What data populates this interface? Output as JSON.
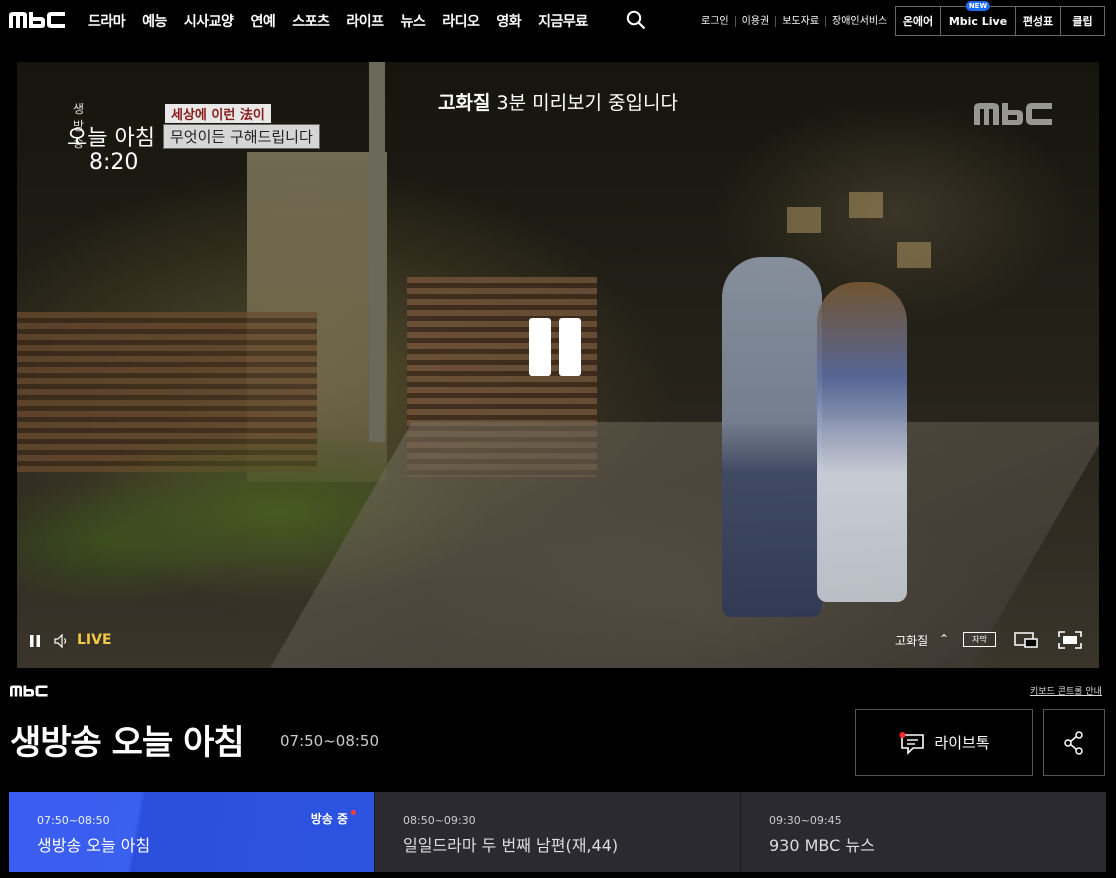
{
  "nav": {
    "logo": "MBC",
    "items": [
      "드라마",
      "예능",
      "시사교양",
      "연예",
      "스포츠",
      "라이프",
      "뉴스",
      "라디오",
      "영화",
      "지금무료"
    ],
    "util": [
      "로그인",
      "이용권",
      "보도자료",
      "장애인서비스"
    ],
    "buttons": {
      "onair": "온에어",
      "mbic_live": "Mbic Live",
      "mbic_new": "NEW",
      "schedule": "편성표",
      "clip": "클립"
    }
  },
  "player": {
    "bug_small": "생방송",
    "bug_title": "오늘 아침",
    "bug_time": "8:20",
    "bug_sub1": "세상에 이런 法이",
    "bug_sub2": "무엇이든 구해드립니다",
    "preview_quality": "고화질",
    "preview_rest": " 3분 미리보기 중입니다",
    "watermark": "MBC",
    "live_label": "LIVE",
    "quality_label": "고화질",
    "caption_label": "자막"
  },
  "info": {
    "channel": "MBC",
    "keyboard_guide": "키보드 콘트롤 안내",
    "title": "생방송 오늘 아침",
    "time": "07:50~08:50",
    "livetalk": "라이브톡"
  },
  "schedule": [
    {
      "time": "07:50~08:50",
      "name": "생방송 오늘 아침",
      "status": "방송 중"
    },
    {
      "time": "08:50~09:30",
      "name": "일일드라마 두 번째 남편(재,44)"
    },
    {
      "time": "09:30~09:45",
      "name": "930 MBC 뉴스"
    }
  ],
  "colors": {
    "accent": "#3a60ef",
    "live": "#f3c743",
    "badge": "#1e6bff",
    "onair_dot": "#ff3b3b"
  }
}
